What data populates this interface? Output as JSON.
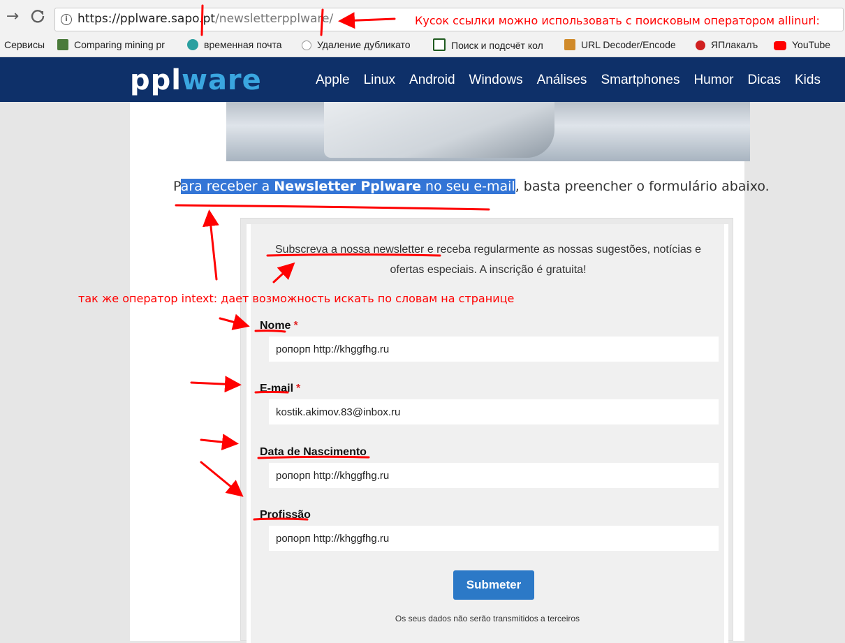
{
  "browser": {
    "back_glyph": "→",
    "reload_glyph": "C",
    "url_host": "https://pplware.sapo.pt",
    "url_path": "/newsletterpplware/",
    "bookmarks": [
      {
        "label": "Сервисы",
        "icon": "apps-icon",
        "color": ""
      },
      {
        "label": "Comparing mining pr",
        "icon": "mining-icon",
        "color": "#4a7a3a"
      },
      {
        "label": "временная почта",
        "icon": "mail-icon",
        "color": "#2aa0a0"
      },
      {
        "label": "Удаление дубликато",
        "icon": "magnifier-icon",
        "color": "#888888"
      },
      {
        "label": "Поиск и подсчёт кол",
        "icon": "letter-a-icon",
        "color": "#1e5a1e"
      },
      {
        "label": "URL Decoder/Encode",
        "icon": "tool-icon",
        "color": "#d08a2a"
      },
      {
        "label": "ЯПлакалъ",
        "icon": "yap-icon",
        "color": "#d02020"
      },
      {
        "label": "YouTube",
        "icon": "youtube-icon",
        "color": "#ff0000"
      }
    ]
  },
  "site": {
    "logo_ppl": "ppl",
    "logo_ware": "ware",
    "nav": [
      "Apple",
      "Linux",
      "Android",
      "Windows",
      "Análises",
      "Smartphones",
      "Humor",
      "Dicas",
      "Kids"
    ]
  },
  "page": {
    "intro_first": "P",
    "intro_sel_1": "ara receber a ",
    "intro_sel_bold": "Newsletter Pplware",
    "intro_sel_2": " no seu e-mail",
    "intro_rest": ", basta preencher o formulário abaixo."
  },
  "form": {
    "description": "Subscreva a nossa newsletter e receba regularmente as nossas sugestões, notícias e ofertas especiais. A inscrição é gratuita!",
    "required_mark": "*",
    "fields": [
      {
        "label": "Nome",
        "required": true,
        "value": "ропорп http://khggfhg.ru"
      },
      {
        "label": "E-mail",
        "required": true,
        "value": "kostik.akimov.83@inbox.ru"
      },
      {
        "label": "Data de Nascimento",
        "required": false,
        "value": "ропорп http://khggfhg.ru"
      },
      {
        "label": "Profissão",
        "required": false,
        "value": "ропорп http://khggfhg.ru"
      }
    ],
    "submit_label": "Submeter",
    "privacy_note": "Os seus dados não serão transmitidos a terceiros"
  },
  "annotations": {
    "url_note": "Кусок ссылки можно использовать с поисковым оператором allinurl:",
    "intext_note": "так же оператор intext: дает возможность искать по словам на странице",
    "color": "#ff0000"
  }
}
